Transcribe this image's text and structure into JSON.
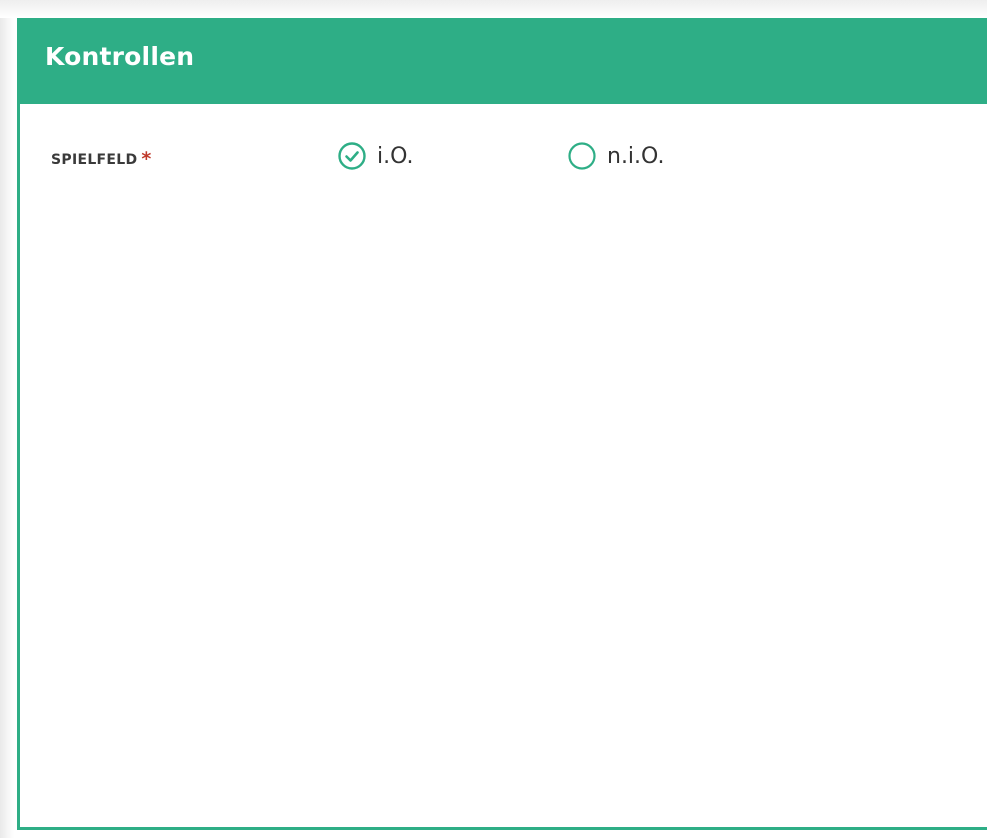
{
  "panel": {
    "title": "Kontrollen",
    "accent_color": "#2eae86"
  },
  "field": {
    "label": "SPIELFELD",
    "required_marker": "*",
    "required_color": "#c0392b",
    "options": [
      {
        "label": "i.O.",
        "selected": true,
        "icon": "check-circle-icon"
      },
      {
        "label": "n.i.O.",
        "selected": false,
        "icon": "radio-empty-icon"
      }
    ]
  }
}
